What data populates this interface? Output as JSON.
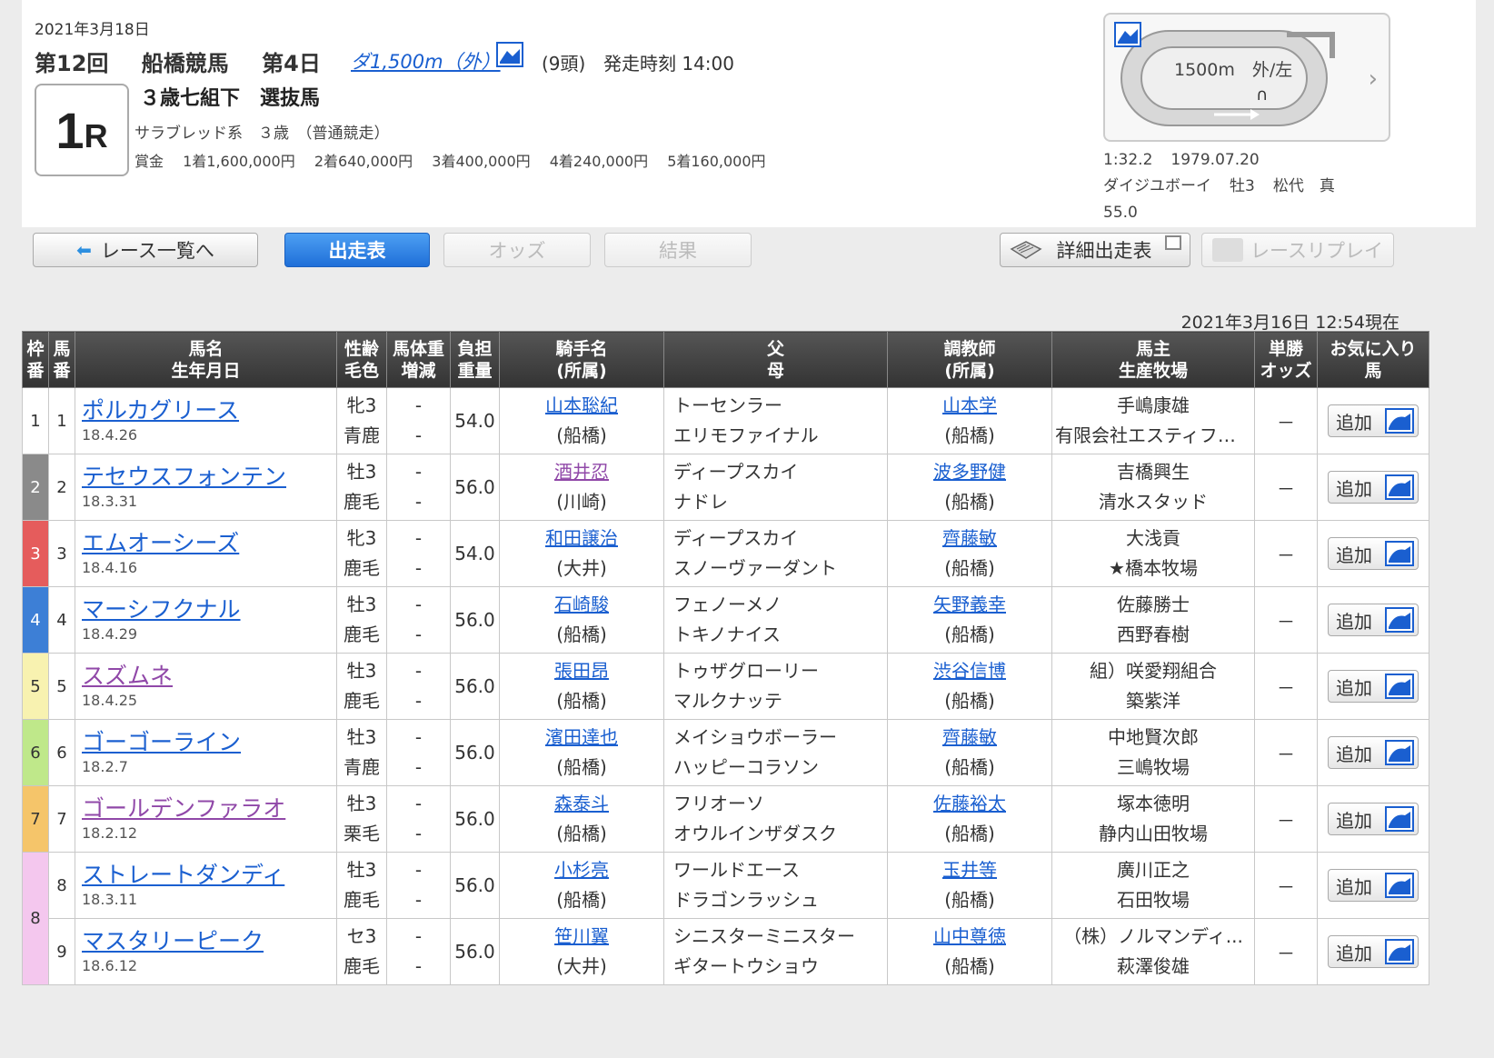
{
  "header": {
    "date": "2021年3月18日",
    "kai": "第12回",
    "venue": "船橋競馬",
    "day": "第4日",
    "course": "ダ1,500m（外）",
    "heads": "(9頭)",
    "post_time": "発走時刻 14:00",
    "race_number": "1",
    "race_suffix": "R",
    "race_name": "３歳七組下　選抜馬",
    "conditions": "サラブレッド系　３歳　（普通競走）",
    "prize_label": "賞金",
    "prizes": [
      "1着1,600,000円",
      "2着640,000円",
      "3着400,000円",
      "4着240,000円",
      "5着160,000円"
    ]
  },
  "track": {
    "label": "1500m　外/左",
    "direction": "∩",
    "record_time": "1:32.2",
    "record_date": "1979.07.20",
    "record_horse": "ダイジユボーイ",
    "record_sexage": "牡3",
    "record_jockey": "松代　真",
    "record_weight": "55.0"
  },
  "nav": {
    "back": "レース一覧へ",
    "entries": "出走表",
    "odds": "オッズ",
    "results": "結果",
    "detail": "詳細出走表",
    "replay": "レースリプレイ"
  },
  "timestamp": "2021年3月16日 12:54現在",
  "table": {
    "headers": {
      "waku": [
        "枠",
        "番"
      ],
      "uma": [
        "馬",
        "番"
      ],
      "name": [
        "馬名",
        "生年月日"
      ],
      "sex": [
        "性齢",
        "毛色"
      ],
      "bw": [
        "馬体重",
        "増減"
      ],
      "wt": [
        "負担",
        "重量"
      ],
      "jockey": [
        "騎手名",
        "(所属)"
      ],
      "parents": [
        "父",
        "母"
      ],
      "trainer": [
        "調教師",
        "(所属)"
      ],
      "owner": [
        "馬主",
        "生産牧場"
      ],
      "odds": [
        "単勝",
        "オッズ"
      ],
      "fav": [
        "お気に入り",
        "馬"
      ]
    },
    "add_label": "追加",
    "rows": [
      {
        "waku": "1",
        "uma": "1",
        "name": "ポルカグリース",
        "bday": "18.4.26",
        "sex": "牝3",
        "color": "青鹿",
        "bw": "-",
        "bwd": "-",
        "wt": "54.0",
        "jockey": "山本聡紀",
        "jaff": "(船橋)",
        "sire": "トーセンラー",
        "dam": "エリモファイナル",
        "trainer": "山本学",
        "taff": "(船橋)",
        "owner": "手嶋康雄",
        "breeder": "有限会社エスティファ...",
        "odds": "－"
      },
      {
        "waku": "2",
        "uma": "2",
        "name": "テセウスフォンテン",
        "bday": "18.3.31",
        "sex": "牡3",
        "color": "鹿毛",
        "bw": "-",
        "bwd": "-",
        "wt": "56.0",
        "jockey": "酒井忍",
        "jaff": "(川崎)",
        "sire": "ディープスカイ",
        "dam": "ナドレ",
        "trainer": "波多野健",
        "taff": "(船橋)",
        "owner": "吉橋興生",
        "breeder": "清水スタッド",
        "odds": "－"
      },
      {
        "waku": "3",
        "uma": "3",
        "name": "エムオーシーズ",
        "bday": "18.4.16",
        "sex": "牝3",
        "color": "鹿毛",
        "bw": "-",
        "bwd": "-",
        "wt": "54.0",
        "jockey": "和田譲治",
        "jaff": "(大井)",
        "sire": "ディープスカイ",
        "dam": "スノーヴァーダント",
        "trainer": "齊藤敏",
        "taff": "(船橋)",
        "owner": "大浅貢",
        "breeder": "★橋本牧場",
        "odds": "－"
      },
      {
        "waku": "4",
        "uma": "4",
        "name": "マーシフクナル",
        "bday": "18.4.29",
        "sex": "牡3",
        "color": "鹿毛",
        "bw": "-",
        "bwd": "-",
        "wt": "56.0",
        "jockey": "石崎駿",
        "jaff": "(船橋)",
        "sire": "フェノーメノ",
        "dam": "トキノナイス",
        "trainer": "矢野義幸",
        "taff": "(船橋)",
        "owner": "佐藤勝士",
        "breeder": "西野春樹",
        "odds": "－"
      },
      {
        "waku": "5",
        "uma": "5",
        "name": "スズムネ",
        "bday": "18.4.25",
        "sex": "牡3",
        "color": "鹿毛",
        "bw": "-",
        "bwd": "-",
        "wt": "56.0",
        "jockey": "張田昂",
        "jaff": "(船橋)",
        "sire": "トゥザグローリー",
        "dam": "マルクナッテ",
        "trainer": "渋谷信博",
        "taff": "(船橋)",
        "owner": "組）咲愛翔組合",
        "breeder": "築紫洋",
        "odds": "－"
      },
      {
        "waku": "6",
        "uma": "6",
        "name": "ゴーゴーライン",
        "bday": "18.2.7",
        "sex": "牡3",
        "color": "青鹿",
        "bw": "-",
        "bwd": "-",
        "wt": "56.0",
        "jockey": "濱田達也",
        "jaff": "(船橋)",
        "sire": "メイショウボーラー",
        "dam": "ハッピーコラソン",
        "trainer": "齊藤敏",
        "taff": "(船橋)",
        "owner": "中地賢次郎",
        "breeder": "三嶋牧場",
        "odds": "－"
      },
      {
        "waku": "7",
        "uma": "7",
        "name": "ゴールデンファラオ",
        "bday": "18.2.12",
        "sex": "牡3",
        "color": "栗毛",
        "bw": "-",
        "bwd": "-",
        "wt": "56.0",
        "jockey": "森泰斗",
        "jaff": "(船橋)",
        "sire": "フリオーソ",
        "dam": "オウルインザダスク",
        "trainer": "佐藤裕太",
        "taff": "(船橋)",
        "owner": "塚本徳明",
        "breeder": "静内山田牧場",
        "odds": "－"
      },
      {
        "waku": "8",
        "uma": "8",
        "name": "ストレートダンディ",
        "bday": "18.3.11",
        "sex": "牡3",
        "color": "鹿毛",
        "bw": "-",
        "bwd": "-",
        "wt": "56.0",
        "jockey": "小杉亮",
        "jaff": "(船橋)",
        "sire": "ワールドエース",
        "dam": "ドラゴンラッシュ",
        "trainer": "玉井等",
        "taff": "(船橋)",
        "owner": "廣川正之",
        "breeder": "石田牧場",
        "odds": "－"
      },
      {
        "waku": "8",
        "uma": "9",
        "name": "マスタリーピーク",
        "bday": "18.6.12",
        "sex": "セ3",
        "color": "鹿毛",
        "bw": "-",
        "bwd": "-",
        "wt": "56.0",
        "jockey": "笹川翼",
        "jaff": "(大井)",
        "sire": "シニスターミニスター",
        "dam": "ギタートウショウ",
        "trainer": "山中尊徳",
        "taff": "(船橋)",
        "owner": "（株）ノルマンディ...",
        "breeder": "萩澤俊雄",
        "odds": "－"
      }
    ]
  },
  "colors": {
    "waku": {
      "1": "#ffffff",
      "2": "#8a8a8a",
      "3": "#e55c5c",
      "4": "#3d7fd6",
      "5": "#f8f2b0",
      "6": "#bfe88a",
      "7": "#f5c56a",
      "8": "#f4c7ee"
    },
    "waku_text": {
      "1": "#333333",
      "2": "#ffffff",
      "3": "#ffffff",
      "4": "#ffffff",
      "5": "#333333",
      "6": "#333333",
      "7": "#333333",
      "8": "#333333"
    },
    "link": "#1a5fd0",
    "visited": "#9048a8",
    "active_tab": "#2f7fe6"
  },
  "visited": {
    "names": [
      "スズムネ",
      "ゴールデンファラオ"
    ],
    "jockeys": [
      "酒井忍"
    ]
  }
}
